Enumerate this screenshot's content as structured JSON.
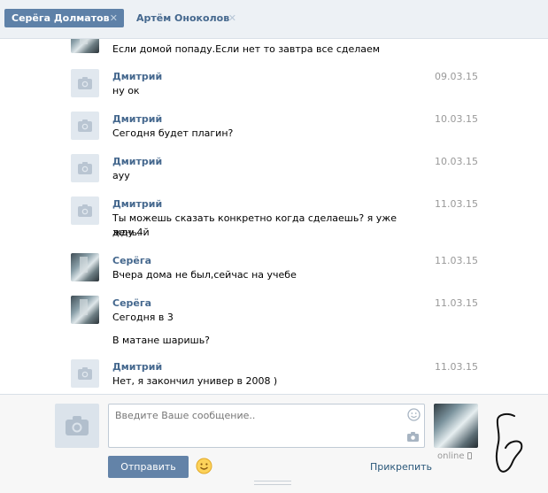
{
  "tabs": [
    {
      "label": "Серёга Долматов",
      "active": true
    },
    {
      "label": "Артём Оноколов",
      "active": false
    }
  ],
  "messages": [
    {
      "avatar": "photo-avatar",
      "author": "",
      "date": "",
      "lines": [
        "Если домой попаду.Если нет то завтра все сделаем"
      ]
    },
    {
      "avatar": "camera-icon",
      "author": "Дмитрий",
      "date": "09.03.15",
      "lines": [
        "ну ок"
      ]
    },
    {
      "avatar": "camera-icon",
      "author": "Дмитрий",
      "date": "10.03.15",
      "lines": [
        "Сегодня будет плагин?"
      ]
    },
    {
      "avatar": "camera-icon",
      "author": "Дмитрий",
      "date": "10.03.15",
      "lines": [
        "ауу"
      ]
    },
    {
      "avatar": "camera-icon",
      "author": "Дмитрий",
      "date": "11.03.15",
      "lines": [
        "Ты можешь сказать конкретно когда сделаешь? я уже жду 4й",
        "день."
      ]
    },
    {
      "avatar": "photo-avatar",
      "author": "Серёга",
      "date": "11.03.15",
      "lines": [
        "Вчера дома не был,сейчас на учебе"
      ]
    },
    {
      "avatar": "photo-avatar",
      "author": "Серёга",
      "date": "11.03.15",
      "lines": [
        "Сегодня в 3",
        "",
        "В матане шаришь?"
      ]
    },
    {
      "avatar": "camera-icon",
      "author": "Дмитрий",
      "date": "11.03.15",
      "lines": [
        "Нет, я закончил универ в 2008 )"
      ]
    }
  ],
  "composer": {
    "placeholder": "Введите Ваше сообщение..",
    "send_label": "Отправить",
    "attach_label": "Прикрепить",
    "status": "online"
  },
  "colors": {
    "accent": "#5e81a8",
    "link": "#45688e",
    "date": "#999999"
  }
}
